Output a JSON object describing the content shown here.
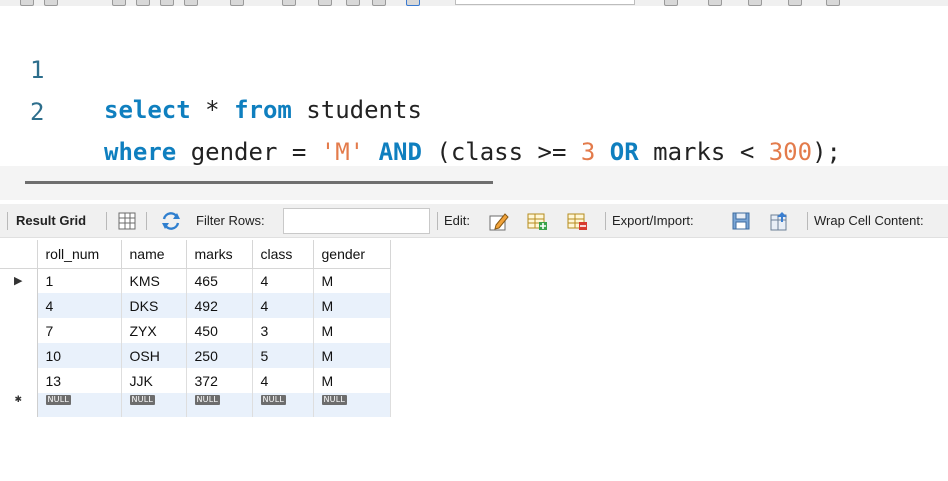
{
  "editor": {
    "lines": [
      {
        "num": "1",
        "tokens": [
          {
            "t": "select",
            "k": "kw"
          },
          {
            "t": " * ",
            "k": ""
          },
          {
            "t": "from",
            "k": "kw"
          },
          {
            "t": " students",
            "k": ""
          }
        ]
      },
      {
        "num": "2",
        "tokens": [
          {
            "t": "where",
            "k": "kw"
          },
          {
            "t": " gender = ",
            "k": ""
          },
          {
            "t": "'M'",
            "k": "str"
          },
          {
            "t": " ",
            "k": ""
          },
          {
            "t": "AND",
            "k": "kw"
          },
          {
            "t": " (class >= ",
            "k": ""
          },
          {
            "t": "3",
            "k": "num"
          },
          {
            "t": " ",
            "k": ""
          },
          {
            "t": "OR",
            "k": "kw"
          },
          {
            "t": " marks < ",
            "k": ""
          },
          {
            "t": "300",
            "k": "num"
          },
          {
            "t": ");",
            "k": ""
          }
        ]
      }
    ]
  },
  "result_toolbar": {
    "result_grid": "Result Grid",
    "filter_rows": "Filter Rows:",
    "filter_value": "",
    "edit": "Edit:",
    "export_import": "Export/Import:",
    "wrap_cell": "Wrap Cell Content:"
  },
  "grid": {
    "columns": [
      "roll_num",
      "name",
      "marks",
      "class",
      "gender"
    ],
    "rows": [
      [
        "1",
        "KMS",
        "465",
        "4",
        "M"
      ],
      [
        "4",
        "DKS",
        "492",
        "4",
        "M"
      ],
      [
        "7",
        "ZYX",
        "450",
        "3",
        "M"
      ],
      [
        "10",
        "OSH",
        "250",
        "5",
        "M"
      ],
      [
        "13",
        "JJK",
        "372",
        "4",
        "M"
      ]
    ],
    "null_label": "NULL",
    "current_row_marker": "▶",
    "new_row_marker": "✱"
  },
  "colors": {
    "keyword": "#0f7fbf",
    "literal": "#e37b4b",
    "row_highlight": "#e9f1fb"
  }
}
